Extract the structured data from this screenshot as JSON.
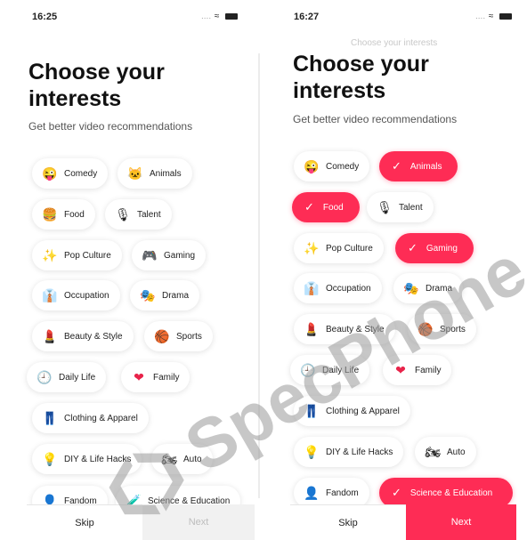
{
  "left_screen": {
    "time": "16:25",
    "status_dots": "....",
    "title": "Choose your interests",
    "subtitle": "Get better video recommendations",
    "chips": [
      {
        "label": "Comedy",
        "icon": "😜",
        "icon_name": "laughing-face-icon"
      },
      {
        "label": "Animals",
        "icon": "🐱",
        "icon_name": "cat-icon"
      },
      {
        "label": "Food",
        "icon": "🍔",
        "icon_name": "burger-icon"
      },
      {
        "label": "Talent",
        "icon": "🎙",
        "icon_name": "microphone-icon"
      },
      {
        "label": "Pop Culture",
        "icon": "✨",
        "icon_name": "sparkles-icon"
      },
      {
        "label": "Gaming",
        "icon": "🎮",
        "icon_name": "gamepad-icon"
      },
      {
        "label": "Occupation",
        "icon": "👔",
        "icon_name": "tie-icon"
      },
      {
        "label": "Drama",
        "icon": "🎭",
        "icon_name": "drama-masks-icon"
      },
      {
        "label": "Beauty & Style",
        "icon": "💄",
        "icon_name": "lipstick-icon"
      },
      {
        "label": "Sports",
        "icon": "🏀",
        "icon_name": "basketball-icon"
      },
      {
        "label": "Daily Life",
        "icon": "🕘",
        "icon_name": "clock-icon"
      },
      {
        "label": "Family",
        "icon": "❤",
        "icon_name": "heart-icon"
      },
      {
        "label": "Clothing & Apparel",
        "icon": "👖",
        "icon_name": "jeans-icon"
      },
      {
        "label": "DIY & Life Hacks",
        "icon": "💡",
        "icon_name": "lightbulb-icon"
      },
      {
        "label": "Auto",
        "icon": "🏍",
        "icon_name": "motorcycle-icon"
      },
      {
        "label": "Fandom",
        "icon": "👤",
        "icon_name": "fan-icon"
      },
      {
        "label": "Science & Education",
        "icon": "🧪",
        "icon_name": "science-icon"
      }
    ],
    "skip_label": "Skip",
    "next_label": "Next"
  },
  "right_screen": {
    "time": "16:27",
    "status_dots": "....",
    "mini_title": "Choose your interests",
    "title": "Choose your interests",
    "subtitle": "Get better video recommendations",
    "chips": [
      {
        "label": "Comedy",
        "icon": "😜",
        "icon_name": "laughing-face-icon",
        "selected": false
      },
      {
        "label": "Animals",
        "icon": "✓",
        "icon_name": "checkmark-icon",
        "selected": true
      },
      {
        "label": "Food",
        "icon": "✓",
        "icon_name": "checkmark-icon",
        "selected": true
      },
      {
        "label": "Talent",
        "icon": "🎙",
        "icon_name": "microphone-icon",
        "selected": false
      },
      {
        "label": "Pop Culture",
        "icon": "✨",
        "icon_name": "sparkles-icon",
        "selected": false
      },
      {
        "label": "Gaming",
        "icon": "✓",
        "icon_name": "checkmark-icon",
        "selected": true
      },
      {
        "label": "Occupation",
        "icon": "👔",
        "icon_name": "tie-icon",
        "selected": false
      },
      {
        "label": "Drama",
        "icon": "🎭",
        "icon_name": "drama-masks-icon",
        "selected": false
      },
      {
        "label": "Beauty & Style",
        "icon": "💄",
        "icon_name": "lipstick-icon",
        "selected": false
      },
      {
        "label": "Sports",
        "icon": "🏀",
        "icon_name": "basketball-icon",
        "selected": false
      },
      {
        "label": "Daily Life",
        "icon": "🕘",
        "icon_name": "clock-icon",
        "selected": false
      },
      {
        "label": "Family",
        "icon": "❤",
        "icon_name": "heart-icon",
        "selected": false
      },
      {
        "label": "Clothing & Apparel",
        "icon": "👖",
        "icon_name": "jeans-icon",
        "selected": false
      },
      {
        "label": "DIY & Life Hacks",
        "icon": "💡",
        "icon_name": "lightbulb-icon",
        "selected": false
      },
      {
        "label": "Auto",
        "icon": "🏍",
        "icon_name": "motorcycle-icon",
        "selected": false
      },
      {
        "label": "Fandom",
        "icon": "👤",
        "icon_name": "fan-icon",
        "selected": false
      },
      {
        "label": "Science & Education",
        "icon": "✓",
        "icon_name": "checkmark-icon",
        "selected": true
      }
    ],
    "skip_label": "Skip",
    "next_label": "Next"
  },
  "watermark": {
    "text": "SpecPhone",
    "color": "#9a9a9a"
  },
  "colors": {
    "accent": "#fe2c55",
    "chip_bg": "#ffffff",
    "disabled_bg": "#f1f1f1"
  }
}
